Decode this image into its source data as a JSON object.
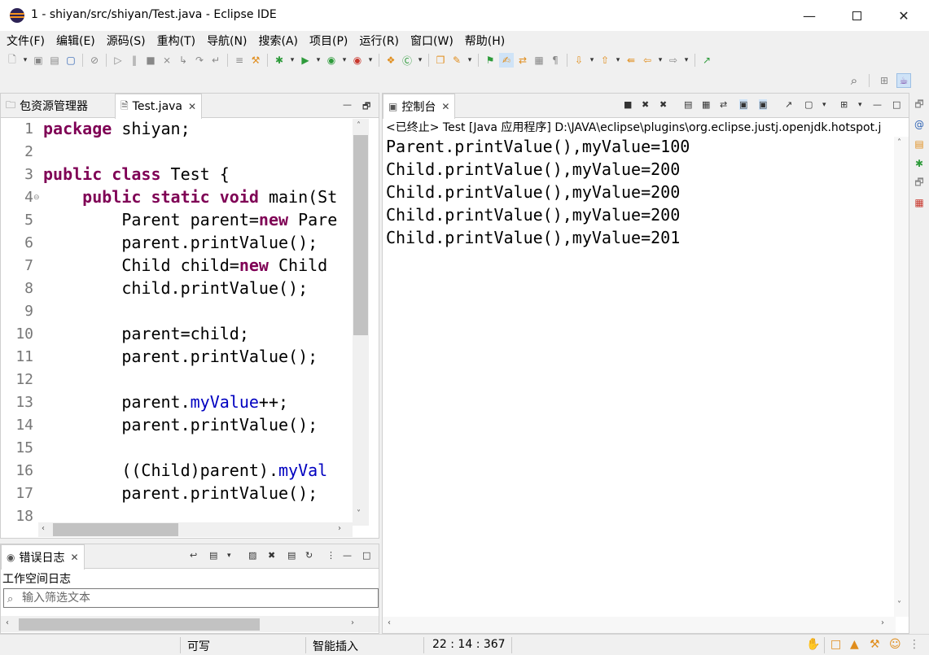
{
  "window": {
    "title": "1 - shiyan/src/shiyan/Test.java - Eclipse IDE"
  },
  "menu": [
    "文件(F)",
    "编辑(E)",
    "源码(S)",
    "重构(T)",
    "导航(N)",
    "搜索(A)",
    "项目(P)",
    "运行(R)",
    "窗口(W)",
    "帮助(H)"
  ],
  "editor_panel": {
    "tab_package_explorer": "包资源管理器",
    "tab_file": "Test.java",
    "lines": [
      {
        "n": "1",
        "html": "<span class=\"kw\">package</span> shiyan;"
      },
      {
        "n": "2",
        "html": ""
      },
      {
        "n": "3",
        "html": "<span class=\"kw\">public class</span> Test {"
      },
      {
        "n": "4",
        "html": "    <span class=\"kw\">public static void</span> main(St"
      },
      {
        "n": "5",
        "html": "        Parent parent=<span class=\"kw\">new</span> Pare"
      },
      {
        "n": "6",
        "html": "        parent.printValue();"
      },
      {
        "n": "7",
        "html": "        Child child=<span class=\"kw\">new</span> Child"
      },
      {
        "n": "8",
        "html": "        child.printValue();"
      },
      {
        "n": "9",
        "html": ""
      },
      {
        "n": "10",
        "html": "        parent=child;"
      },
      {
        "n": "11",
        "html": "        parent.printValue();"
      },
      {
        "n": "12",
        "html": ""
      },
      {
        "n": "13",
        "html": "        parent.<span class=\"fld\">myValue</span>++;"
      },
      {
        "n": "14",
        "html": "        parent.printValue();"
      },
      {
        "n": "15",
        "html": ""
      },
      {
        "n": "16",
        "html": "        ((Child)parent).<span class=\"fld\">myVal</span>"
      },
      {
        "n": "17",
        "html": "        parent.printValue();"
      },
      {
        "n": "18",
        "html": ""
      }
    ]
  },
  "console_panel": {
    "tab": "控制台",
    "header": "<已终止> Test [Java 应用程序] D:\\JAVA\\eclipse\\plugins\\org.eclipse.justj.openjdk.hotspot.j",
    "output": [
      "Parent.printValue(),myValue=100",
      "Child.printValue(),myValue=200",
      "Child.printValue(),myValue=200",
      "Child.printValue(),myValue=200",
      "Child.printValue(),myValue=201"
    ]
  },
  "errorlog_panel": {
    "tab": "错误日志",
    "workspace_label": "工作空间日志",
    "filter_placeholder": "输入筛选文本"
  },
  "status": {
    "writable": "可写",
    "insert_mode": "智能插入",
    "position": "22 : 14 : 367"
  }
}
